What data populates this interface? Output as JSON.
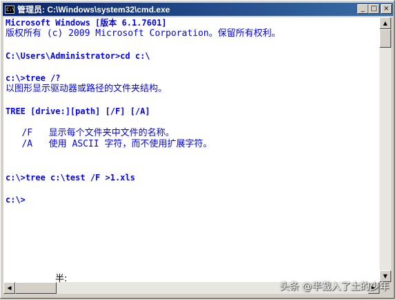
{
  "window": {
    "title": "管理员: C:\\Windows\\system32\\cmd.exe",
    "icon_label": "C:\\",
    "buttons": {
      "minimize": "_",
      "maximize": "□",
      "close": "×"
    }
  },
  "console": {
    "lines": [
      "Microsoft Windows [版本 6.1.7601]",
      "版权所有 (c) 2009 Microsoft Corporation。保留所有权利。",
      "",
      "C:\\Users\\Administrator>cd c:\\",
      "",
      "c:\\>tree /?",
      "以图形显示驱动器或路径的文件夹结构。",
      "",
      "TREE [drive:][path] [/F] [/A]",
      "",
      "   /F   显示每个文件夹中文件的名称。",
      "   /A   使用 ASCII 字符，而不使用扩展字符。",
      "",
      "",
      "c:\\>tree c:\\test /F >1.xls",
      "",
      "c:\\>"
    ],
    "text_color": "#0000ff",
    "background": "#ffffff"
  },
  "ime_status": "半:",
  "watermark": "头条 @半截入了土的少年"
}
